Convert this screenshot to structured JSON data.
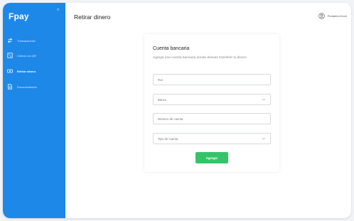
{
  "brand": {
    "name": "Fpay",
    "accent": "#1e88e8",
    "button_color": "#35c46a"
  },
  "sidebar": {
    "collapse_icon": "double-chevron-left-icon",
    "items": [
      {
        "label": "Transacciones",
        "icon": "arrows-transfer-icon",
        "active": false
      },
      {
        "label": "Cobrar con QR",
        "icon": "qr-code-icon",
        "active": false
      },
      {
        "label": "Retirar dinero",
        "icon": "money-icon",
        "active": true
      },
      {
        "label": "Documentación",
        "icon": "document-icon",
        "active": false
      }
    ]
  },
  "header": {
    "title": "Retirar dinero",
    "user_name": "Pedalería Koch",
    "user_icon": "user-circle-icon"
  },
  "form": {
    "title": "Cuenta bancaria",
    "description": "Agrega una cuenta bancaria donde deseas transferir tu dinero",
    "fields": {
      "rut": "Rut",
      "banco": "Banco",
      "numero_cuenta": "Número de cuenta",
      "tipo_cuenta": "Tipo de cuenta"
    },
    "submit_label": "Agregar"
  }
}
